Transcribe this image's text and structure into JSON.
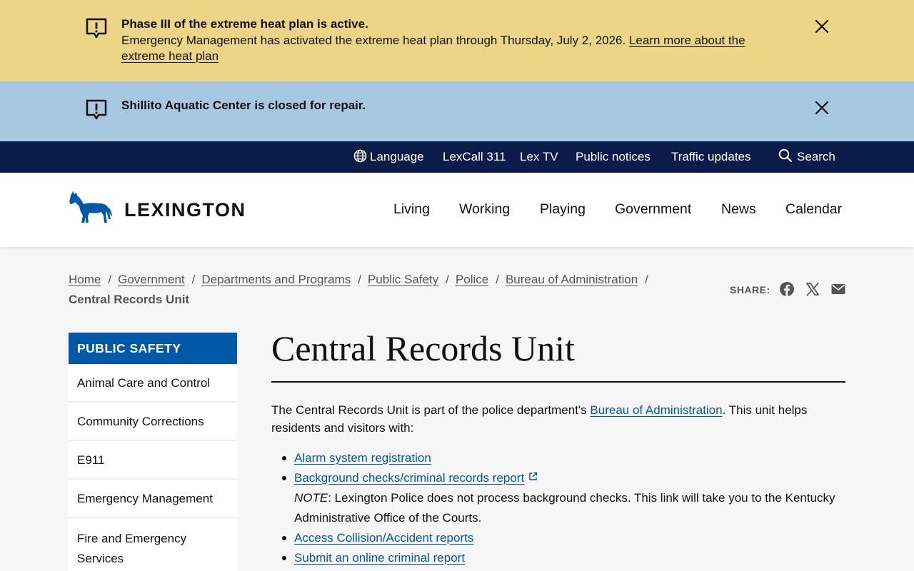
{
  "alerts": [
    {
      "title": "Phase III of the extreme heat plan is active.",
      "body": "Emergency Management has activated the extreme heat plan through Thursday, July 2, 2026. ",
      "link": "Learn more about the extreme heat plan",
      "icon": "alert-icon",
      "bg": "#edd588"
    },
    {
      "title": "Shillito Aquatic Center is closed for repair.",
      "icon": "alert-icon",
      "bg": "#a7c8e0"
    }
  ],
  "utility_nav": {
    "language": "Language",
    "lexcall": "LexCall 311",
    "lextv": "Lex TV",
    "notices": "Public notices",
    "traffic": "Traffic updates",
    "search": "Search"
  },
  "header": {
    "logo": "LEXINGTON",
    "nav": [
      "Living",
      "Working",
      "Playing",
      "Government",
      "News",
      "Calendar"
    ]
  },
  "breadcrumb": {
    "items": [
      "Home",
      "Government",
      "Departments and Programs",
      "Public Safety",
      "Police",
      "Bureau of Administration"
    ],
    "current": "Central Records Unit"
  },
  "share": {
    "label": "SHARE:",
    "icons": [
      "facebook-icon",
      "x-icon",
      "email-icon"
    ]
  },
  "sidebar": {
    "heading": "PUBLIC SAFETY",
    "items": [
      "Animal Care and Control",
      "Community Corrections",
      "E911",
      "Emergency Management",
      "Fire and Emergency Services"
    ]
  },
  "main": {
    "title": "Central Records Unit",
    "intro_before": "The Central Records Unit is part of the police department's ",
    "intro_link": "Bureau of Administration",
    "intro_after": ". This unit helps residents and visitors with:",
    "links": [
      "Alarm system registration",
      "Background checks/criminal records report",
      "Access Collision/Accident reports",
      "Submit an online criminal report"
    ],
    "note_label": "NOTE",
    "note_text": ": Lexington Police does not process background checks. This link will take you to the Kentucky Administrative Office of the Courts."
  },
  "colors": {
    "utility_bg": "#0c1c4a",
    "brand_blue": "#0058a6",
    "link": "#0058a6"
  }
}
